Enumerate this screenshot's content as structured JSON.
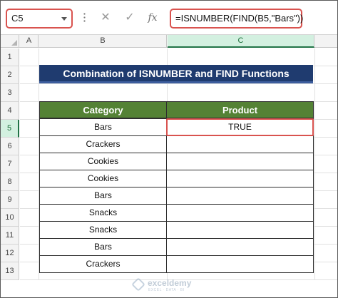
{
  "formula_bar": {
    "name_box": "C5",
    "cancel_glyph": "✕",
    "enter_glyph": "✓",
    "fx_label": "fx",
    "formula": "=ISNUMBER(FIND(B5,\"Bars\"))"
  },
  "columns": [
    "A",
    "B",
    "C"
  ],
  "selected_column": "C",
  "rows": [
    "1",
    "2",
    "3",
    "4",
    "5",
    "6",
    "7",
    "8",
    "9",
    "10",
    "11",
    "12",
    "13"
  ],
  "selected_row": "5",
  "title": "Combination of ISNUMBER and FIND Functions",
  "table": {
    "headers": [
      "Category",
      "Product"
    ],
    "rows": [
      [
        "Bars",
        "TRUE"
      ],
      [
        "Crackers",
        ""
      ],
      [
        "Cookies",
        ""
      ],
      [
        "Cookies",
        ""
      ],
      [
        "Bars",
        ""
      ],
      [
        "Snacks",
        ""
      ],
      [
        "Snacks",
        ""
      ],
      [
        "Bars",
        ""
      ],
      [
        "Crackers",
        ""
      ]
    ]
  },
  "watermark": {
    "name": "exceldemy",
    "tagline": "EXCEL · DATA · BI"
  },
  "colors": {
    "banner": "#1f3b6f",
    "table_header": "#548235",
    "highlight": "#d9534f",
    "selection": "#217346"
  }
}
